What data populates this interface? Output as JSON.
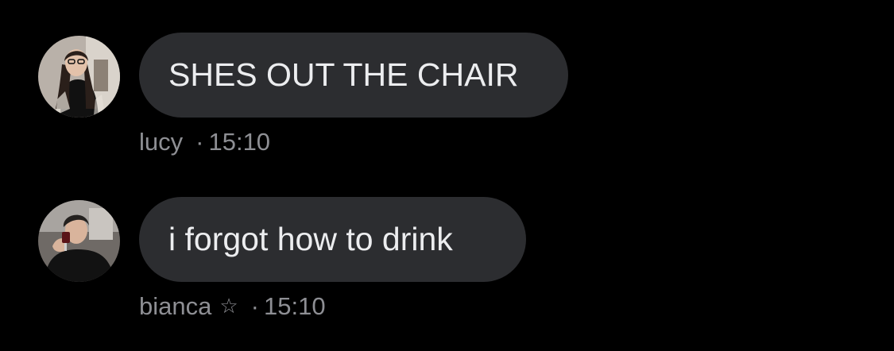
{
  "messages": [
    {
      "avatar_icon": "user-avatar-photo",
      "text": "SHES OUT THE CHAIR",
      "sender": "lucy",
      "separator": "·",
      "time": "15:10"
    },
    {
      "avatar_icon": "user-avatar-photo",
      "text": "i forgot how to drink",
      "sender": "bianca",
      "badge_icon": "star-outline-icon",
      "badge_glyph": "☆",
      "separator": "·",
      "time": "15:10"
    }
  ],
  "colors": {
    "background": "#000000",
    "bubble": "#2c2d30",
    "bubble_text": "#ecedef",
    "meta_text": "#8e8f94"
  }
}
